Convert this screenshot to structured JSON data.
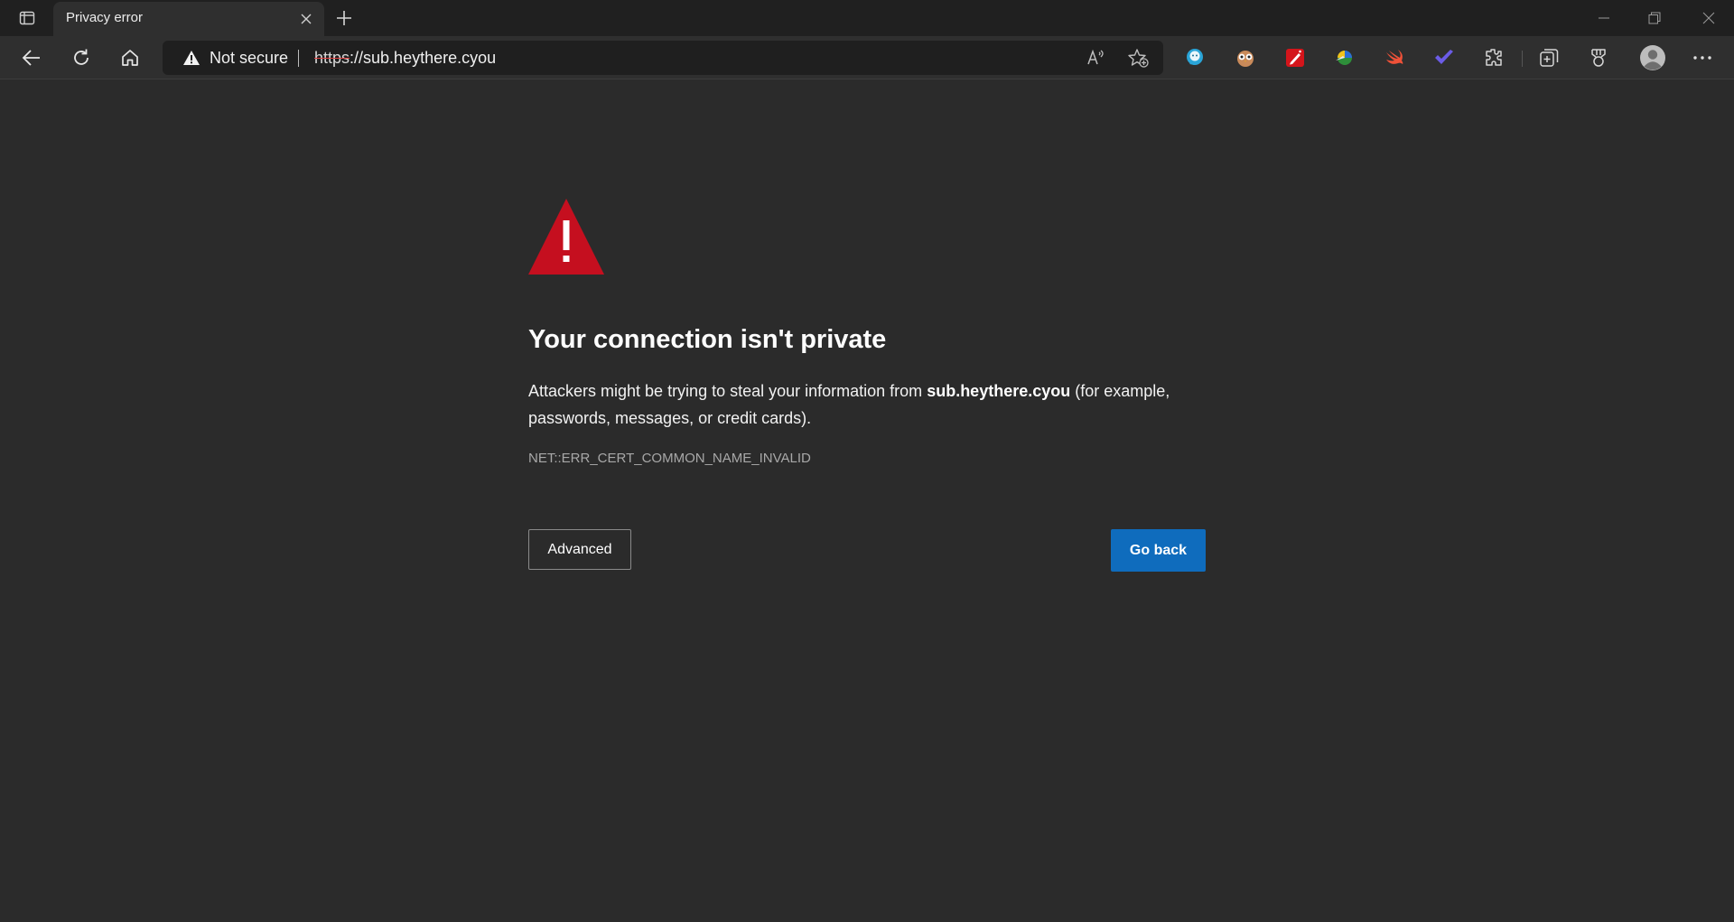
{
  "tab": {
    "title": "Privacy error"
  },
  "address_bar": {
    "security_label": "Not secure",
    "url_scheme": "https",
    "url_rest": "://sub.heythere.cyou"
  },
  "page": {
    "heading": "Your connection isn't private",
    "message_before": "Attackers might be trying to steal your information from ",
    "message_host": "sub.heythere.cyou",
    "message_after": " (for example, passwords, messages, or credit cards).",
    "error_code": "NET::ERR_CERT_COMMON_NAME_INVALID",
    "advanced_label": "Advanced",
    "go_back_label": "Go back"
  },
  "colors": {
    "warning_red": "#c50f1f",
    "primary_button": "#0f6cbd",
    "page_background": "#2b2b2b"
  },
  "icons": {
    "toolbar": [
      "back-icon",
      "refresh-icon",
      "home-icon"
    ],
    "omnibox": [
      "warning-icon",
      "read-aloud-icon",
      "add-favorite-icon"
    ],
    "extensions": [
      "chat-extension-icon",
      "owl-extension-icon",
      "red-pen-extension-icon",
      "color-picker-extension-icon",
      "swift-extension-icon",
      "checkmark-extension-icon",
      "extensions-icon"
    ],
    "right": [
      "collections-icon",
      "rewards-icon",
      "profile-icon",
      "more-icon"
    ]
  }
}
